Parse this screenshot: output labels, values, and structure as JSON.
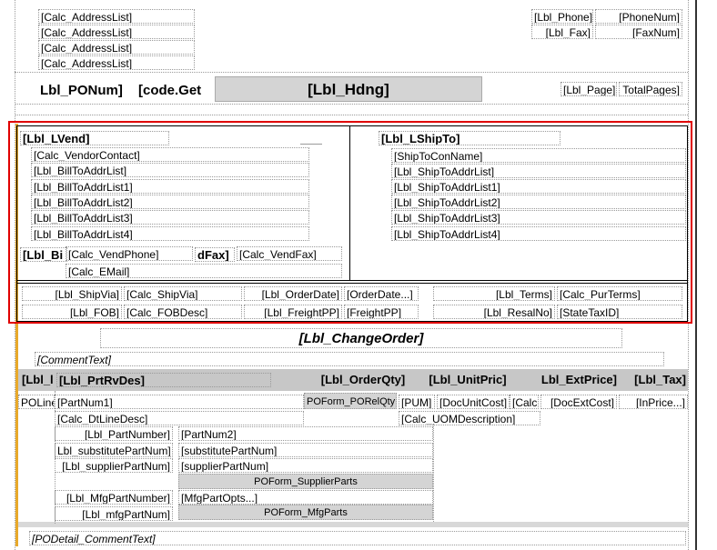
{
  "header": {
    "address_fields": [
      "[Calc_AddressList]",
      "[Calc_AddressList]",
      "[Calc_AddressList]",
      "[Calc_AddressList]"
    ],
    "lbl_phone": "[Lbl_Phone]",
    "phone_num": "[PhoneNum]",
    "lbl_fax": "[Lbl_Fax]",
    "fax_num": "[FaxNum]",
    "lbl_ponum": "Lbl_PONum]",
    "code_get": "[code.Get",
    "lbl_hdng": "[Lbl_Hdng]",
    "lbl_page": "[Lbl_Page]",
    "total_pages": "TotalPages]"
  },
  "vendor": {
    "lbl_lvend": "[Lbl_LVend]",
    "vendor_contact": "[Calc_VendorContact]",
    "billto": [
      "[Lbl_BillToAddrList]",
      "[Lbl_BillToAddrList1]",
      "[Lbl_BillToAddrList2]",
      "[Lbl_BillToAddrList3]",
      "[Lbl_BillToAddrList4]"
    ],
    "lbl_bi": "[Lbl_Bi",
    "vend_phone": "[Calc_VendPhone]",
    "dfax": "dFax]",
    "vend_fax": "[Calc_VendFax]",
    "email": "[Calc_EMail]"
  },
  "shipto": {
    "lbl_lshipto": "[Lbl_LShipTo]",
    "con_name": "[ShipToConName]",
    "addr": [
      "[Lbl_ShipToAddrList]",
      "[Lbl_ShipToAddrList1]",
      "[Lbl_ShipToAddrList2]",
      "[Lbl_ShipToAddrList3]",
      "[Lbl_ShipToAddrList4]"
    ]
  },
  "terms": {
    "lbl_shipvia": "[Lbl_ShipVia]",
    "calc_shipvia": "[Calc_ShipVia]",
    "lbl_orderdate": "[Lbl_OrderDate]",
    "orderdate": "[OrderDate...]",
    "lbl_terms": "[Lbl_Terms]",
    "calc_purterms": "[Calc_PurTerms]",
    "lbl_fob": "[Lbl_FOB]",
    "calc_fobdesc": "[Calc_FOBDesc]",
    "lbl_freightpp": "[Lbl_FreightPP]",
    "freightpp": "[FreightPP]",
    "lbl_resalno": "[Lbl_ResalNo]",
    "statetaxid": "[StateTaxID]"
  },
  "change_order": "[Lbl_ChangeOrder]",
  "comment_text": "[CommentText]",
  "columns": {
    "c1": "[Lbl_l",
    "c2": "[Lbl_PrtRvDes]",
    "c3": "[Lbl_OrderQty]",
    "c4": "[Lbl_UnitPric]",
    "c5": "Lbl_ExtPrice]",
    "c6": "[Lbl_Tax]"
  },
  "detail": {
    "poline": "POLine",
    "partnum1": "[PartNum1]",
    "porelqty": "POForm_PORelQty",
    "pum": "[PUM]",
    "docunitcost": "[DocUnitCost]",
    "calc": "[Calc",
    "docextcost": "[DocExtCost]",
    "inprice": "[InPrice...]",
    "dtlinedesc": "[Calc_DtLineDesc]",
    "uomdesc": "[Calc_UOMDescription]",
    "lbl_partnumber": "[Lbl_PartNumber]",
    "partnum2": "[PartNum2]",
    "lbl_substitute": "Lbl_substitutePartNum]",
    "substitute": "[substitutePartNum]",
    "lbl_supplier": "[Lbl_supplierPartNum]",
    "supplier": "[supplierPartNum]",
    "supplierparts": "POForm_SupplierParts",
    "lbl_mfgpartnumber": "[Lbl_MfgPartNumber]",
    "mfgpartopts": "[MfgPartOpts...]",
    "lbl_mfgpartnum": "[Lbl_mfgPartNum]",
    "mfgparts": "POForm_MfgParts",
    "podetail_comment": "[PODetail_CommentText]"
  }
}
